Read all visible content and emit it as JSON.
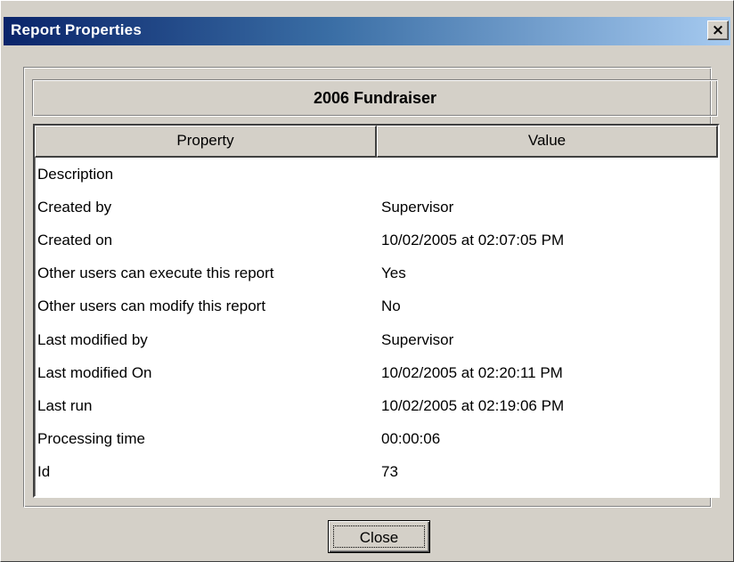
{
  "window": {
    "title": "Report Properties",
    "close_glyph": "×",
    "close_icon": "close-icon"
  },
  "report": {
    "name": "2006 Fundraiser"
  },
  "table": {
    "columns": [
      "Property",
      "Value"
    ],
    "rows": [
      {
        "property": "Description",
        "value": ""
      },
      {
        "property": "Created by",
        "value": "Supervisor"
      },
      {
        "property": "Created on",
        "value": "10/02/2005 at 02:07:05 PM"
      },
      {
        "property": "Other users can execute this report",
        "value": "Yes"
      },
      {
        "property": "Other users can modify this report",
        "value": "No"
      },
      {
        "property": "Last modified by",
        "value": "Supervisor"
      },
      {
        "property": "Last modified On",
        "value": "10/02/2005 at 02:20:11 PM"
      },
      {
        "property": "Last run",
        "value": "10/02/2005 at 02:19:06 PM"
      },
      {
        "property": "Processing time",
        "value": "00:00:06"
      },
      {
        "property": "Id",
        "value": "73"
      }
    ]
  },
  "buttons": {
    "close_label": "Close"
  },
  "colors": {
    "titlebar_start": "#0a246a",
    "titlebar_end": "#a6caf0",
    "face": "#d4d0c8"
  }
}
